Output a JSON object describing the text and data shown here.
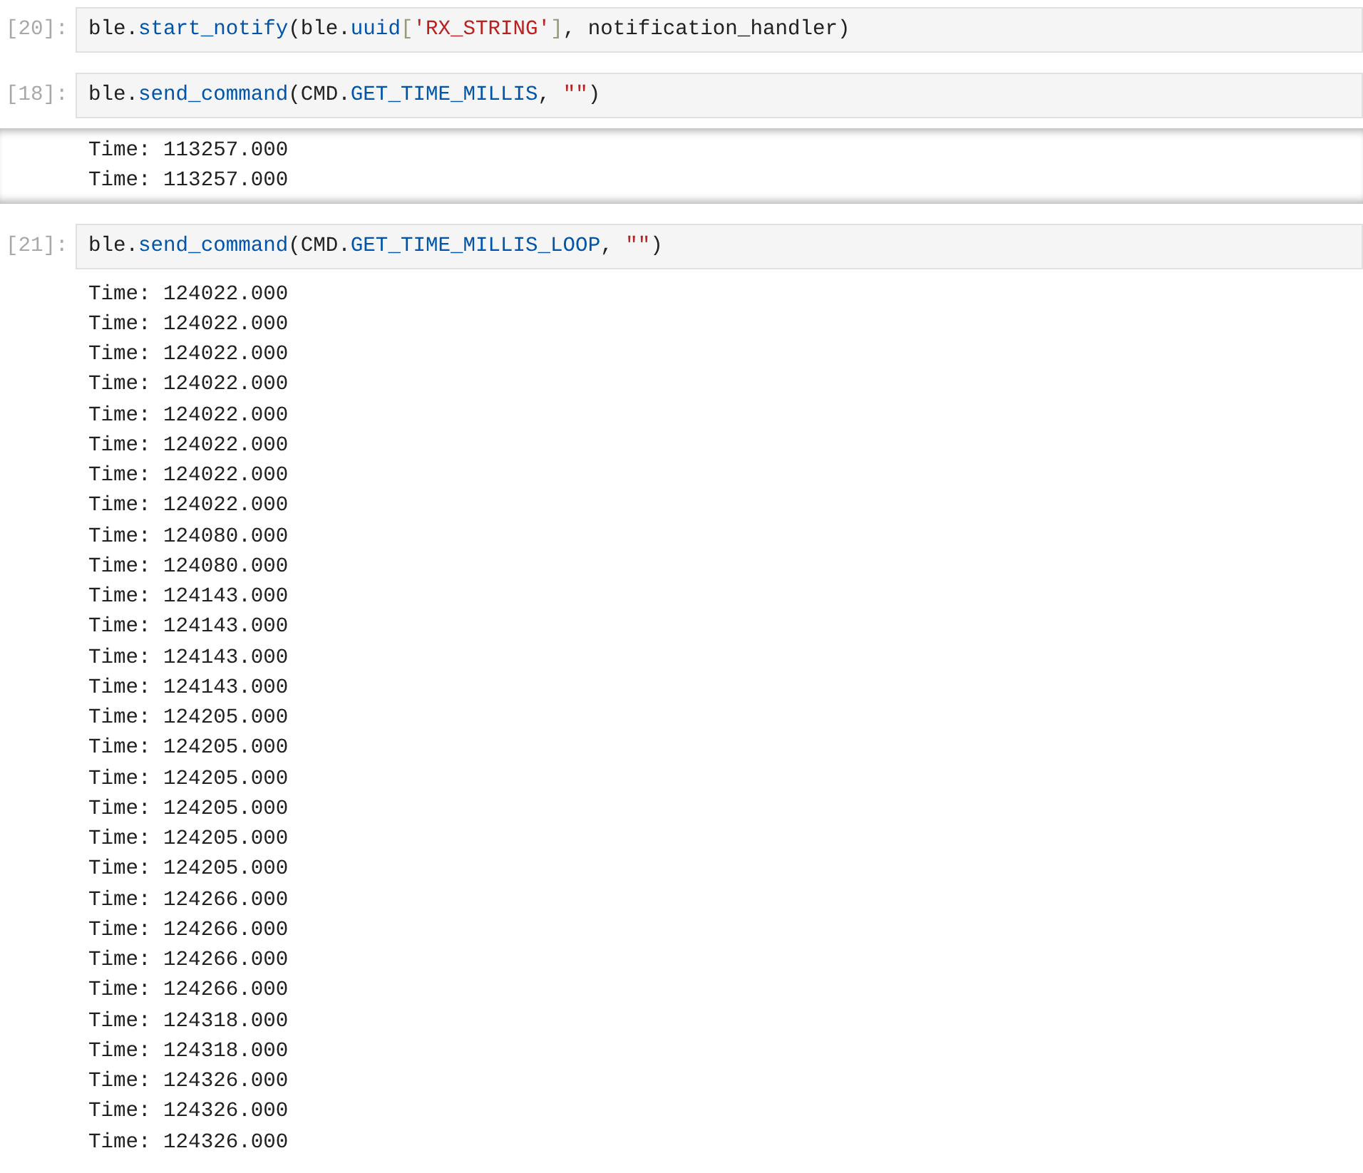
{
  "cells": [
    {
      "prompt": "[20]:",
      "code": [
        {
          "kind": "plain",
          "text": "ble."
        },
        {
          "kind": "attr",
          "text": "start_notify"
        },
        {
          "kind": "plain",
          "text": "(ble."
        },
        {
          "kind": "attr",
          "text": "uuid"
        },
        {
          "kind": "bracket",
          "text": "["
        },
        {
          "kind": "string",
          "text": "'RX_STRING'"
        },
        {
          "kind": "bracket",
          "text": "]"
        },
        {
          "kind": "plain",
          "text": ", notification_handler)"
        }
      ]
    },
    {
      "prompt": "[18]:",
      "code": [
        {
          "kind": "plain",
          "text": "ble."
        },
        {
          "kind": "attr",
          "text": "send_command"
        },
        {
          "kind": "plain",
          "text": "(CMD."
        },
        {
          "kind": "attr",
          "text": "GET_TIME_MILLIS"
        },
        {
          "kind": "plain",
          "text": ", "
        },
        {
          "kind": "string",
          "text": "\"\""
        },
        {
          "kind": "plain",
          "text": ")"
        }
      ],
      "output": [
        "Time: 113257.000",
        "Time: 113257.000"
      ],
      "scrolled": true
    },
    {
      "prompt": "[21]:",
      "code": [
        {
          "kind": "plain",
          "text": "ble."
        },
        {
          "kind": "attr",
          "text": "send_command"
        },
        {
          "kind": "plain",
          "text": "(CMD."
        },
        {
          "kind": "attr",
          "text": "GET_TIME_MILLIS_LOOP"
        },
        {
          "kind": "plain",
          "text": ", "
        },
        {
          "kind": "string",
          "text": "\"\""
        },
        {
          "kind": "plain",
          "text": ")"
        }
      ],
      "output": [
        "Time: 124022.000",
        "Time: 124022.000",
        "Time: 124022.000",
        "Time: 124022.000",
        "Time: 124022.000",
        "Time: 124022.000",
        "Time: 124022.000",
        "Time: 124022.000",
        "Time: 124080.000",
        "Time: 124080.000",
        "Time: 124143.000",
        "Time: 124143.000",
        "Time: 124143.000",
        "Time: 124143.000",
        "Time: 124205.000",
        "Time: 124205.000",
        "Time: 124205.000",
        "Time: 124205.000",
        "Time: 124205.000",
        "Time: 124205.000",
        "Time: 124266.000",
        "Time: 124266.000",
        "Time: 124266.000",
        "Time: 124266.000",
        "Time: 124318.000",
        "Time: 124318.000",
        "Time: 124326.000",
        "Time: 124326.000",
        "Time: 124326.000"
      ],
      "scrolled": false
    }
  ]
}
